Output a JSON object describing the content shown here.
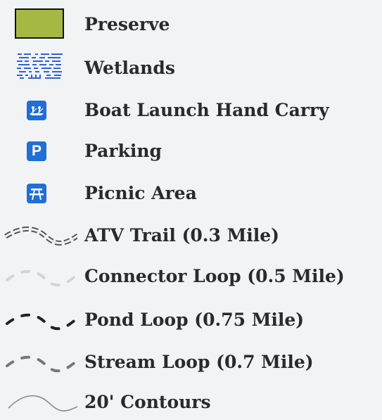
{
  "legend": {
    "items": [
      {
        "label": "Preserve",
        "symbol": "preserve-swatch",
        "color": "#a5b844"
      },
      {
        "label": "Wetlands",
        "symbol": "wetlands-pattern",
        "color": "#2e62d6"
      },
      {
        "label": "Boat Launch Hand Carry",
        "symbol": "canoe-icon",
        "color": "#1f6fd6"
      },
      {
        "label": "Parking",
        "symbol": "parking-icon",
        "color": "#1f6fd6",
        "glyph": "P"
      },
      {
        "label": "Picnic Area",
        "symbol": "picnic-table-icon",
        "color": "#1f6fd6"
      },
      {
        "label": "ATV Trail (0.3 Mile)",
        "symbol": "atv-trail-line",
        "color": "#555555"
      },
      {
        "label": "Connector Loop (0.5 Mile)",
        "symbol": "connector-loop-line",
        "color": "#d4d4d4"
      },
      {
        "label": "Pond Loop (0.75 Mile)",
        "symbol": "pond-loop-line",
        "color": "#222222"
      },
      {
        "label": "Stream Loop (0.7 Mile)",
        "symbol": "stream-loop-line",
        "color": "#777777"
      },
      {
        "label": "20' Contours",
        "symbol": "contour-line",
        "color": "#8a8a8a"
      }
    ]
  }
}
